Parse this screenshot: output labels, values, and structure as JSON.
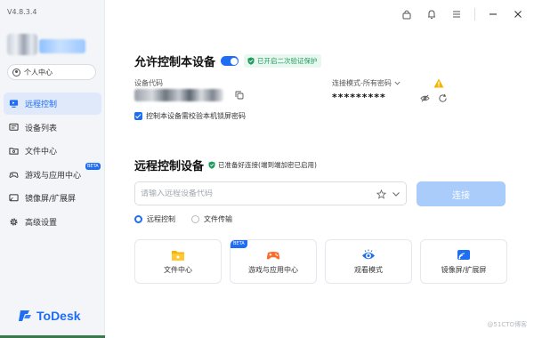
{
  "app": {
    "version": "V4.8.3.4",
    "logo_text": "ToDesk",
    "brand_color": "#1e6df5"
  },
  "sidebar": {
    "personal_center": "个人中心",
    "items": [
      {
        "label": "远程控制",
        "icon": "monitor-icon",
        "active": true
      },
      {
        "label": "设备列表",
        "icon": "device-list-icon"
      },
      {
        "label": "文件中心",
        "icon": "folder-icon"
      },
      {
        "label": "游戏与应用中心",
        "icon": "gamepad-icon",
        "badge": "BETA"
      },
      {
        "label": "镜像屏/扩展屏",
        "icon": "mirror-screen-icon"
      },
      {
        "label": "高级设置",
        "icon": "gear-icon"
      }
    ]
  },
  "topbar": {
    "icons": [
      "lock-icon",
      "bell-icon",
      "menu-icon",
      "minimize-icon",
      "close-icon"
    ]
  },
  "allow_control": {
    "title": "允许控制本设备",
    "toggle_on": true,
    "security_tag": "已开启二次验证保护",
    "device_code_label": "设备代码",
    "password_mode_label": "连接模式-所有密码",
    "password_value": "*********",
    "checkbox_label": "控制本设备需校验本机锁屏密码",
    "checkbox_checked": true
  },
  "remote_control": {
    "title": "远程控制设备",
    "ready_note": "已准备好连接(端到端加密已启用)",
    "input_placeholder": "请输入远程设备代码",
    "connect_label": "连接",
    "radio_options": [
      {
        "label": "远程控制",
        "selected": true
      },
      {
        "label": "文件传输",
        "selected": false
      }
    ],
    "cards": [
      {
        "label": "文件中心",
        "icon": "folder-icon"
      },
      {
        "label": "游戏与应用中心",
        "icon": "gamepad-icon",
        "badge": "BETA"
      },
      {
        "label": "观看模式",
        "icon": "eye-watch-icon"
      },
      {
        "label": "镜像屏/扩展屏",
        "icon": "cast-screen-icon"
      }
    ]
  },
  "watermark": "@51CTO博客"
}
